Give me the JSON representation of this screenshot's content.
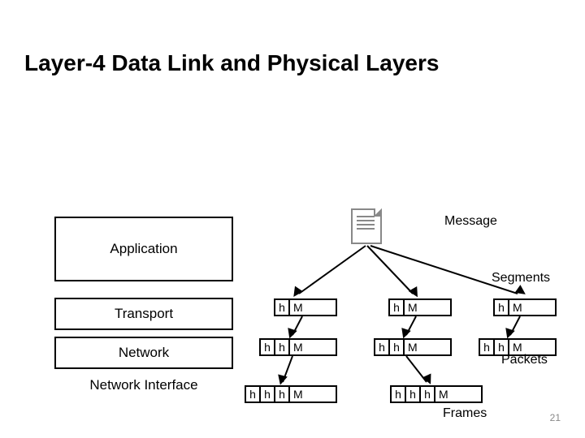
{
  "title": "Layer-4 Data Link and Physical Layers",
  "layers": {
    "application": "Application",
    "transport": "Transport",
    "network": "Network",
    "network_interface": "Network Interface"
  },
  "unit_labels": {
    "message": "Message",
    "segments": "Segments",
    "packets": "Packets",
    "frames": "Frames"
  },
  "cells": {
    "h": "h",
    "M": "M"
  },
  "page_number": "21"
}
